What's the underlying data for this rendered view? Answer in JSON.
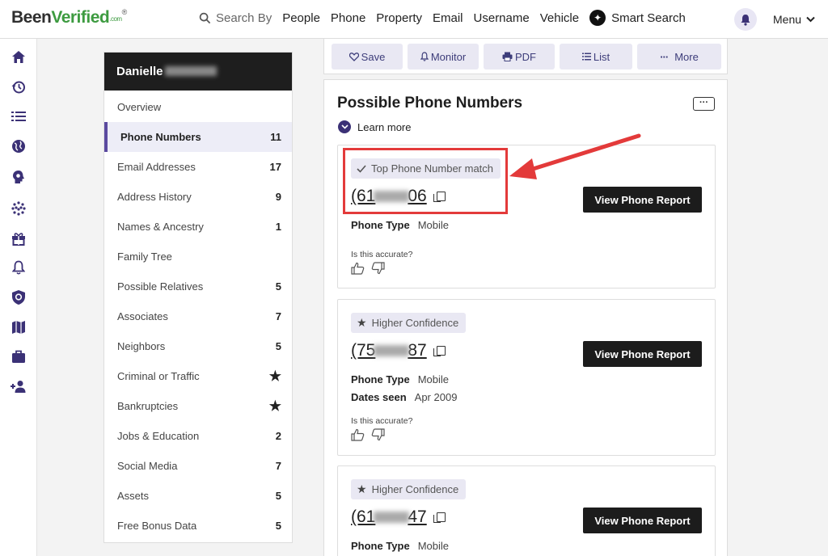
{
  "brand": {
    "part1": "Been",
    "part2": "Verified",
    "suffix": ".com",
    "tm": "®"
  },
  "nav": {
    "search_by": "Search By",
    "items": [
      "People",
      "Phone",
      "Property",
      "Email",
      "Username",
      "Vehicle"
    ],
    "smart_search": "Smart Search",
    "menu_label": "Menu"
  },
  "rail_icons": [
    "home-icon",
    "history-icon",
    "list-icon",
    "globe-icon",
    "brain-icon",
    "family-tree-icon",
    "gift-icon",
    "bell-icon",
    "shield-icon",
    "map-icon",
    "briefcase-icon",
    "add-person-icon"
  ],
  "sidebar": {
    "name": "Danielle",
    "items": [
      {
        "label": "Overview",
        "count": ""
      },
      {
        "label": "Phone Numbers",
        "count": "11",
        "active": true
      },
      {
        "label": "Email Addresses",
        "count": "17"
      },
      {
        "label": "Address History",
        "count": "9"
      },
      {
        "label": "Names & Ancestry",
        "count": "1"
      },
      {
        "label": "Family Tree",
        "count": ""
      },
      {
        "label": "Possible Relatives",
        "count": "5"
      },
      {
        "label": "Associates",
        "count": "7"
      },
      {
        "label": "Neighbors",
        "count": "5"
      },
      {
        "label": "Criminal or Traffic",
        "count": "★"
      },
      {
        "label": "Bankruptcies",
        "count": "★"
      },
      {
        "label": "Jobs & Education",
        "count": "2"
      },
      {
        "label": "Social Media",
        "count": "7"
      },
      {
        "label": "Assets",
        "count": "5"
      },
      {
        "label": "Free Bonus Data",
        "count": "5"
      }
    ]
  },
  "actions": {
    "save": "Save",
    "monitor": "Monitor",
    "pdf": "PDF",
    "list": "List",
    "more": "More"
  },
  "main": {
    "title": "Possible Phone Numbers",
    "learn_more": "Learn more",
    "accurate_q": "Is this accurate?",
    "view_report": "View Phone Report",
    "cards": [
      {
        "badge": "Top Phone Number match",
        "phone_start": "(61",
        "phone_end": "06",
        "type_label": "Phone Type",
        "type": "Mobile"
      },
      {
        "badge": "Higher Confidence",
        "phone_start": "(75",
        "phone_end": "87",
        "type_label": "Phone Type",
        "type": "Mobile",
        "dates_label": "Dates seen",
        "dates": "Apr 2009"
      },
      {
        "badge": "Higher Confidence",
        "phone_start": "(61",
        "phone_end": "47",
        "type_label": "Phone Type",
        "type": "Mobile"
      }
    ]
  },
  "colors": {
    "brand_green": "#3d9b40",
    "accent_purple": "#5b4a9f",
    "highlight_red": "#e33a3a",
    "dark": "#1c1c1c"
  }
}
